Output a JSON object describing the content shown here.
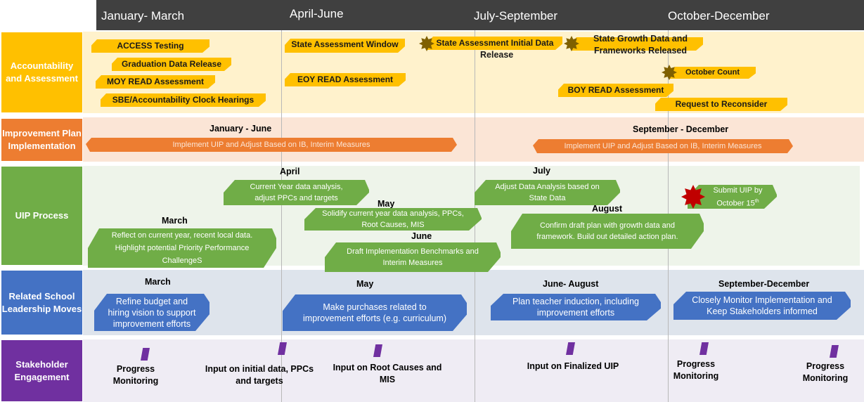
{
  "header": {
    "quarters": [
      "January- March",
      "April-June",
      "July-September",
      "October-December"
    ]
  },
  "lanes": {
    "accountability": {
      "label": "Accountability and Assessment",
      "color": "#ffc000",
      "items": [
        "ACCESS Testing",
        "Graduation Data Release",
        "MOY READ Assessment",
        "SBE/Accountability Clock Hearings",
        "State Assessment Window",
        "EOY READ Assessment",
        "State Assessment Initial Data",
        "Release",
        "State Growth Data and Frameworks Released",
        "October Count",
        "BOY READ Assessment",
        "Request to Reconsider"
      ],
      "milestone_icon": "star-icon"
    },
    "implementation": {
      "label": "Improvement Plan Implementation",
      "color": "#ed7d31",
      "periods": [
        {
          "title": "January - June",
          "text": "Implement UIP and Adjust Based on IB, Interim Measures"
        },
        {
          "title": "September - December",
          "text": "Implement UIP and Adjust Based on IB, Interim Measures"
        }
      ]
    },
    "uip": {
      "label": "UIP Process",
      "color": "#70ad47",
      "steps": [
        {
          "month": "March",
          "text": "Reflect on current year, recent local data. Highlight potential Priority Performance ChallengeS"
        },
        {
          "month": "April",
          "text": "Current Year data analysis, adjust PPCs and targets"
        },
        {
          "month": "May",
          "text": "Solidify current year data analysis, PPCs, Root Causes, MIS"
        },
        {
          "month": "June",
          "text": "Draft Implementation Benchmarks and Interim Measures"
        },
        {
          "month": "July",
          "text": "Adjust Data Analysis based on State Data"
        },
        {
          "month": "August",
          "text": "Confirm draft plan with growth  data and framework.  Build out detailed action plan."
        },
        {
          "month": "",
          "text_line1": "Submit UIP by",
          "text_line2": "October 15",
          "sup": "th"
        }
      ]
    },
    "leadership": {
      "label": "Related School Leadership Moves",
      "color": "#4472c4",
      "moves": [
        {
          "period": "March",
          "text": "Refine budget and hiring vision to support improvement efforts"
        },
        {
          "period": "May",
          "text": "Make purchases related to improvement efforts (e.g. curriculum)"
        },
        {
          "period": "June- August",
          "text": "Plan teacher induction, including improvement efforts"
        },
        {
          "period": "September-December",
          "text": "Closely Monitor Implementation and Keep Stakeholders informed"
        }
      ]
    },
    "stakeholder": {
      "label": "Stakeholder Engagement",
      "color": "#7030a0",
      "events": [
        "Progress Monitoring",
        "Input on initial data, PPCs and targets",
        "Input on Root Causes and MIS",
        "Input on Finalized UIP",
        "Progress Monitoring",
        "Progress Monitoring"
      ]
    }
  }
}
